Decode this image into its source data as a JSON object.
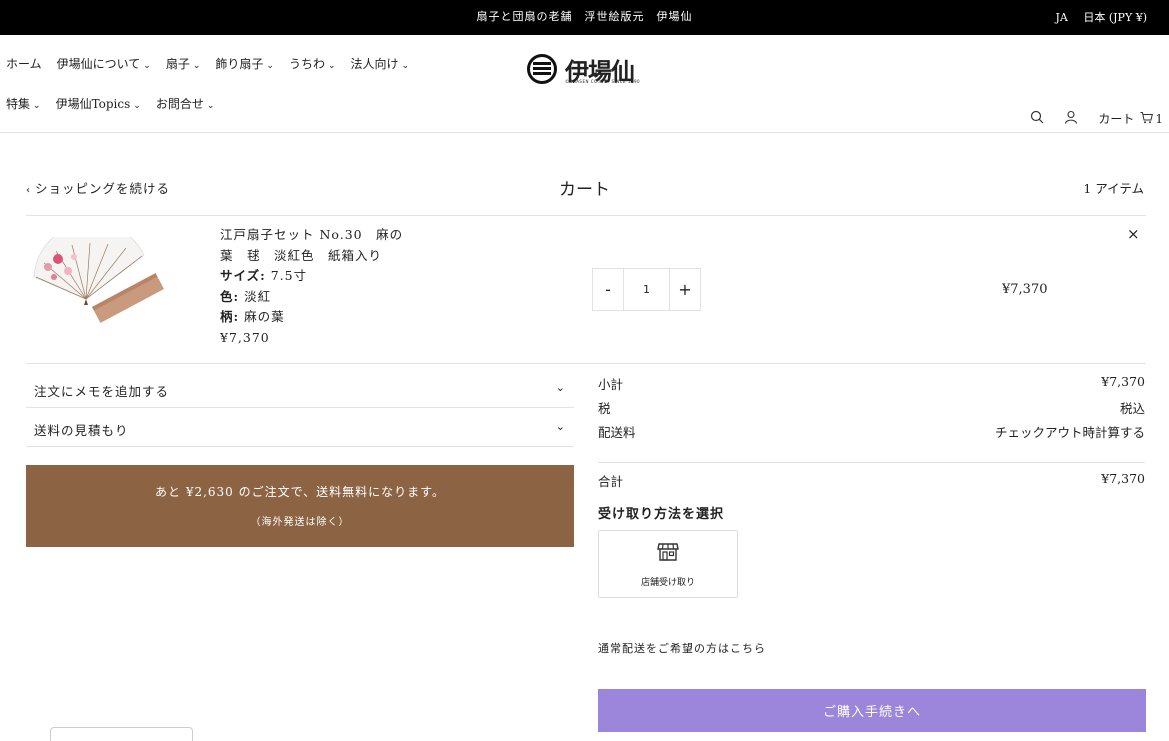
{
  "topbar": {
    "announcement": "扇子と団扇の老舗　浮世絵版元　伊場仙",
    "language": "JA",
    "currency": "日本 (JPY ¥)"
  },
  "nav": {
    "row1": [
      {
        "label": "ホーム",
        "dropdown": false
      },
      {
        "label": "伊場仙について",
        "dropdown": true
      },
      {
        "label": "扇子",
        "dropdown": true
      },
      {
        "label": "飾り扇子",
        "dropdown": true
      },
      {
        "label": "うちわ",
        "dropdown": true
      },
      {
        "label": "法人向け",
        "dropdown": true
      }
    ],
    "row2": [
      {
        "label": "特集",
        "dropdown": true
      },
      {
        "label": "伊場仙Topics",
        "dropdown": true
      },
      {
        "label": "お問合せ",
        "dropdown": true
      }
    ],
    "logo_text": "伊場仙",
    "logo_tagline": "© IBASEN CO.LTD. SINCE 1590",
    "cart_label": "カート",
    "cart_count": "1",
    "icons": [
      "search-icon",
      "account-icon",
      "cart-icon"
    ]
  },
  "cart": {
    "continue_label": "ショッピングを続ける",
    "title": "カート",
    "item_count": "1 アイテム"
  },
  "product": {
    "name_line1": "江戸扇子セット No.30　麻の",
    "name_line2": "葉　毬　淡紅色　紙箱入り",
    "size_key": "サイズ:",
    "size_val": "7.5寸",
    "color_key": "色:",
    "color_val": "淡紅",
    "pattern_key": "柄:",
    "pattern_val": "麻の葉",
    "price": "¥7,370",
    "quantity": "1",
    "minus": "-",
    "plus": "+",
    "line_price": "¥7,370",
    "remove": "×"
  },
  "accordions": [
    {
      "label": "注文にメモを追加する"
    },
    {
      "label": "送料の見積もり"
    }
  ],
  "free_shipping": {
    "message": "あと ¥2,630 のご注文で、送料無料になります。",
    "note": "（海外発送は除く）",
    "remaining": 2630,
    "threshold": 10000,
    "progress": 0.737
  },
  "summary": {
    "subtotal_label": "小計",
    "subtotal": "¥7,370",
    "tax_label": "税",
    "tax": "税込",
    "shipping_label": "配送料",
    "shipping": "チェックアウト時計算する",
    "total_label": "合計",
    "total": "¥7,370"
  },
  "pickup": {
    "title": "受け取り方法を選択",
    "option": "店舗受け取り",
    "normal_delivery": "通常配送をご希望の方はこちら"
  },
  "checkout": {
    "label": "ご購入手続きへ"
  },
  "colors": {
    "topbar": "#000000",
    "free_shipping_bg": "#8c6444",
    "checkout_bg": "#9b86dc",
    "divider": "#e2e2e2"
  }
}
